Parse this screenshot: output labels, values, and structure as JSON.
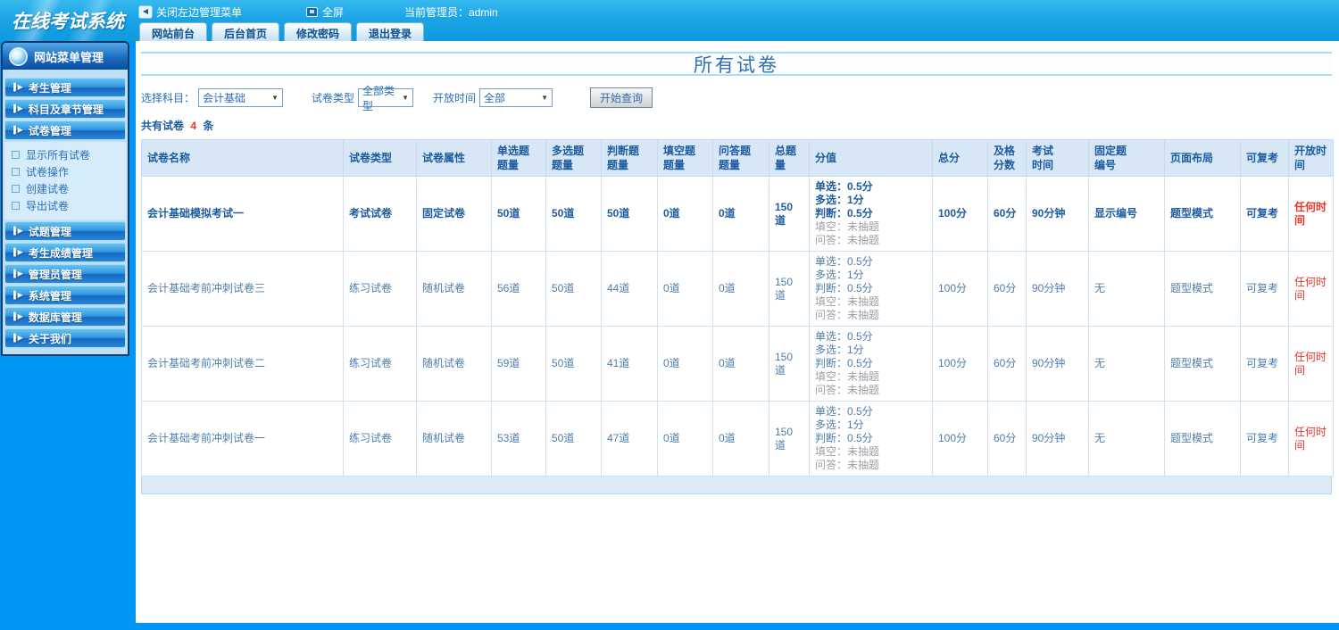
{
  "colors": {
    "accent_red": "#e8352b",
    "primary_blue": "#1b5a9e",
    "sidebar_blue": "#0096f6"
  },
  "topbar": {
    "logo_text": "在线考试系统",
    "close_menu_label": "关闭左边管理菜单",
    "fullscreen_label": "全屏",
    "admin_label": "当前管理员：admin",
    "tabs": [
      {
        "key": "site-front",
        "label": "网站前台"
      },
      {
        "key": "admin-home",
        "label": "后台首页"
      },
      {
        "key": "change-password",
        "label": "修改密码"
      },
      {
        "key": "logout",
        "label": "退出登录"
      }
    ]
  },
  "sidebar": {
    "header": "网站菜单管理",
    "groups_top": [
      {
        "key": "examinee-management",
        "label": "考生管理"
      },
      {
        "key": "subject-chapter-management",
        "label": "科目及章节管理"
      },
      {
        "key": "paper-management",
        "label": "试卷管理"
      }
    ],
    "submenu": [
      {
        "key": "show-all-papers",
        "label": "显示所有试卷"
      },
      {
        "key": "paper-operations",
        "label": "试卷操作"
      },
      {
        "key": "create-paper",
        "label": "创建试卷"
      },
      {
        "key": "export-paper",
        "label": "导出试卷"
      }
    ],
    "groups_bottom": [
      {
        "key": "question-management",
        "label": "试题管理"
      },
      {
        "key": "examinee-score-management",
        "label": "考生成绩管理"
      },
      {
        "key": "admin-management",
        "label": "管理员管理"
      },
      {
        "key": "system-management",
        "label": "系统管理"
      },
      {
        "key": "database-management",
        "label": "数据库管理"
      },
      {
        "key": "about-us",
        "label": "关于我们"
      }
    ]
  },
  "main": {
    "page_title": "所有试卷",
    "filters": {
      "subject_label": "选择科目：",
      "subject_value": "会计基础",
      "type_label": "试卷类型",
      "type_value": "全部类型",
      "open_time_label": "开放时间",
      "open_time_value": "全部",
      "search_button": "开始查询"
    },
    "summary": {
      "prefix": "共有试卷",
      "count": "4",
      "suffix": "条"
    },
    "table": {
      "headers": [
        "试卷名称",
        "试卷类型",
        "试卷属性",
        "单选题\n题量",
        "多选题\n题量",
        "判断题\n题量",
        "填空题\n题量",
        "问答题\n题量",
        "总题量",
        "分值",
        "总分",
        "及格\n分数",
        "考试\n时间",
        "固定题\n编号",
        "页面布局",
        "可复考",
        "开放时间"
      ],
      "rows": [
        {
          "emphasized": true,
          "name": "会计基础模拟考试一",
          "type": "考试试卷",
          "attr": "固定试卷",
          "single_count": "50道",
          "multi_count": "50道",
          "judge_count": "50道",
          "blank_count": "0道",
          "qa_count": "0道",
          "total_count": "150道",
          "score_lines": [
            {
              "text": "单选：0.5分",
              "muted": false
            },
            {
              "text": "多选：1分",
              "muted": false
            },
            {
              "text": "判断：0.5分",
              "muted": false
            },
            {
              "text": "填空：未抽题",
              "muted": true
            },
            {
              "text": "问答：未抽题",
              "muted": true
            }
          ],
          "total_score": "100分",
          "pass_score": "60分",
          "exam_time": "90分钟",
          "fixed_number": "显示编号",
          "page_layout": "题型模式",
          "retake": "可复考",
          "open_time": "任何时间"
        },
        {
          "emphasized": false,
          "name": "会计基础考前冲刺试卷三",
          "type": "练习试卷",
          "attr": "随机试卷",
          "single_count": "56道",
          "multi_count": "50道",
          "judge_count": "44道",
          "blank_count": "0道",
          "qa_count": "0道",
          "total_count": "150道",
          "score_lines": [
            {
              "text": "单选：0.5分",
              "muted": false
            },
            {
              "text": "多选：1分",
              "muted": false
            },
            {
              "text": "判断：0.5分",
              "muted": false
            },
            {
              "text": "填空：未抽题",
              "muted": true
            },
            {
              "text": "问答：未抽题",
              "muted": true
            }
          ],
          "total_score": "100分",
          "pass_score": "60分",
          "exam_time": "90分钟",
          "fixed_number": "无",
          "page_layout": "题型模式",
          "retake": "可复考",
          "open_time": "任何时间"
        },
        {
          "emphasized": false,
          "name": "会计基础考前冲刺试卷二",
          "type": "练习试卷",
          "attr": "随机试卷",
          "single_count": "59道",
          "multi_count": "50道",
          "judge_count": "41道",
          "blank_count": "0道",
          "qa_count": "0道",
          "total_count": "150道",
          "score_lines": [
            {
              "text": "单选：0.5分",
              "muted": false
            },
            {
              "text": "多选：1分",
              "muted": false
            },
            {
              "text": "判断：0.5分",
              "muted": false
            },
            {
              "text": "填空：未抽题",
              "muted": true
            },
            {
              "text": "问答：未抽题",
              "muted": true
            }
          ],
          "total_score": "100分",
          "pass_score": "60分",
          "exam_time": "90分钟",
          "fixed_number": "无",
          "page_layout": "题型模式",
          "retake": "可复考",
          "open_time": "任何时间"
        },
        {
          "emphasized": false,
          "name": "会计基础考前冲刺试卷一",
          "type": "练习试卷",
          "attr": "随机试卷",
          "single_count": "53道",
          "multi_count": "50道",
          "judge_count": "47道",
          "blank_count": "0道",
          "qa_count": "0道",
          "total_count": "150道",
          "score_lines": [
            {
              "text": "单选：0.5分",
              "muted": false
            },
            {
              "text": "多选：1分",
              "muted": false
            },
            {
              "text": "判断：0.5分",
              "muted": false
            },
            {
              "text": "填空：未抽题",
              "muted": true
            },
            {
              "text": "问答：未抽题",
              "muted": true
            }
          ],
          "total_score": "100分",
          "pass_score": "60分",
          "exam_time": "90分钟",
          "fixed_number": "无",
          "page_layout": "题型模式",
          "retake": "可复考",
          "open_time": "任何时间"
        }
      ]
    }
  }
}
